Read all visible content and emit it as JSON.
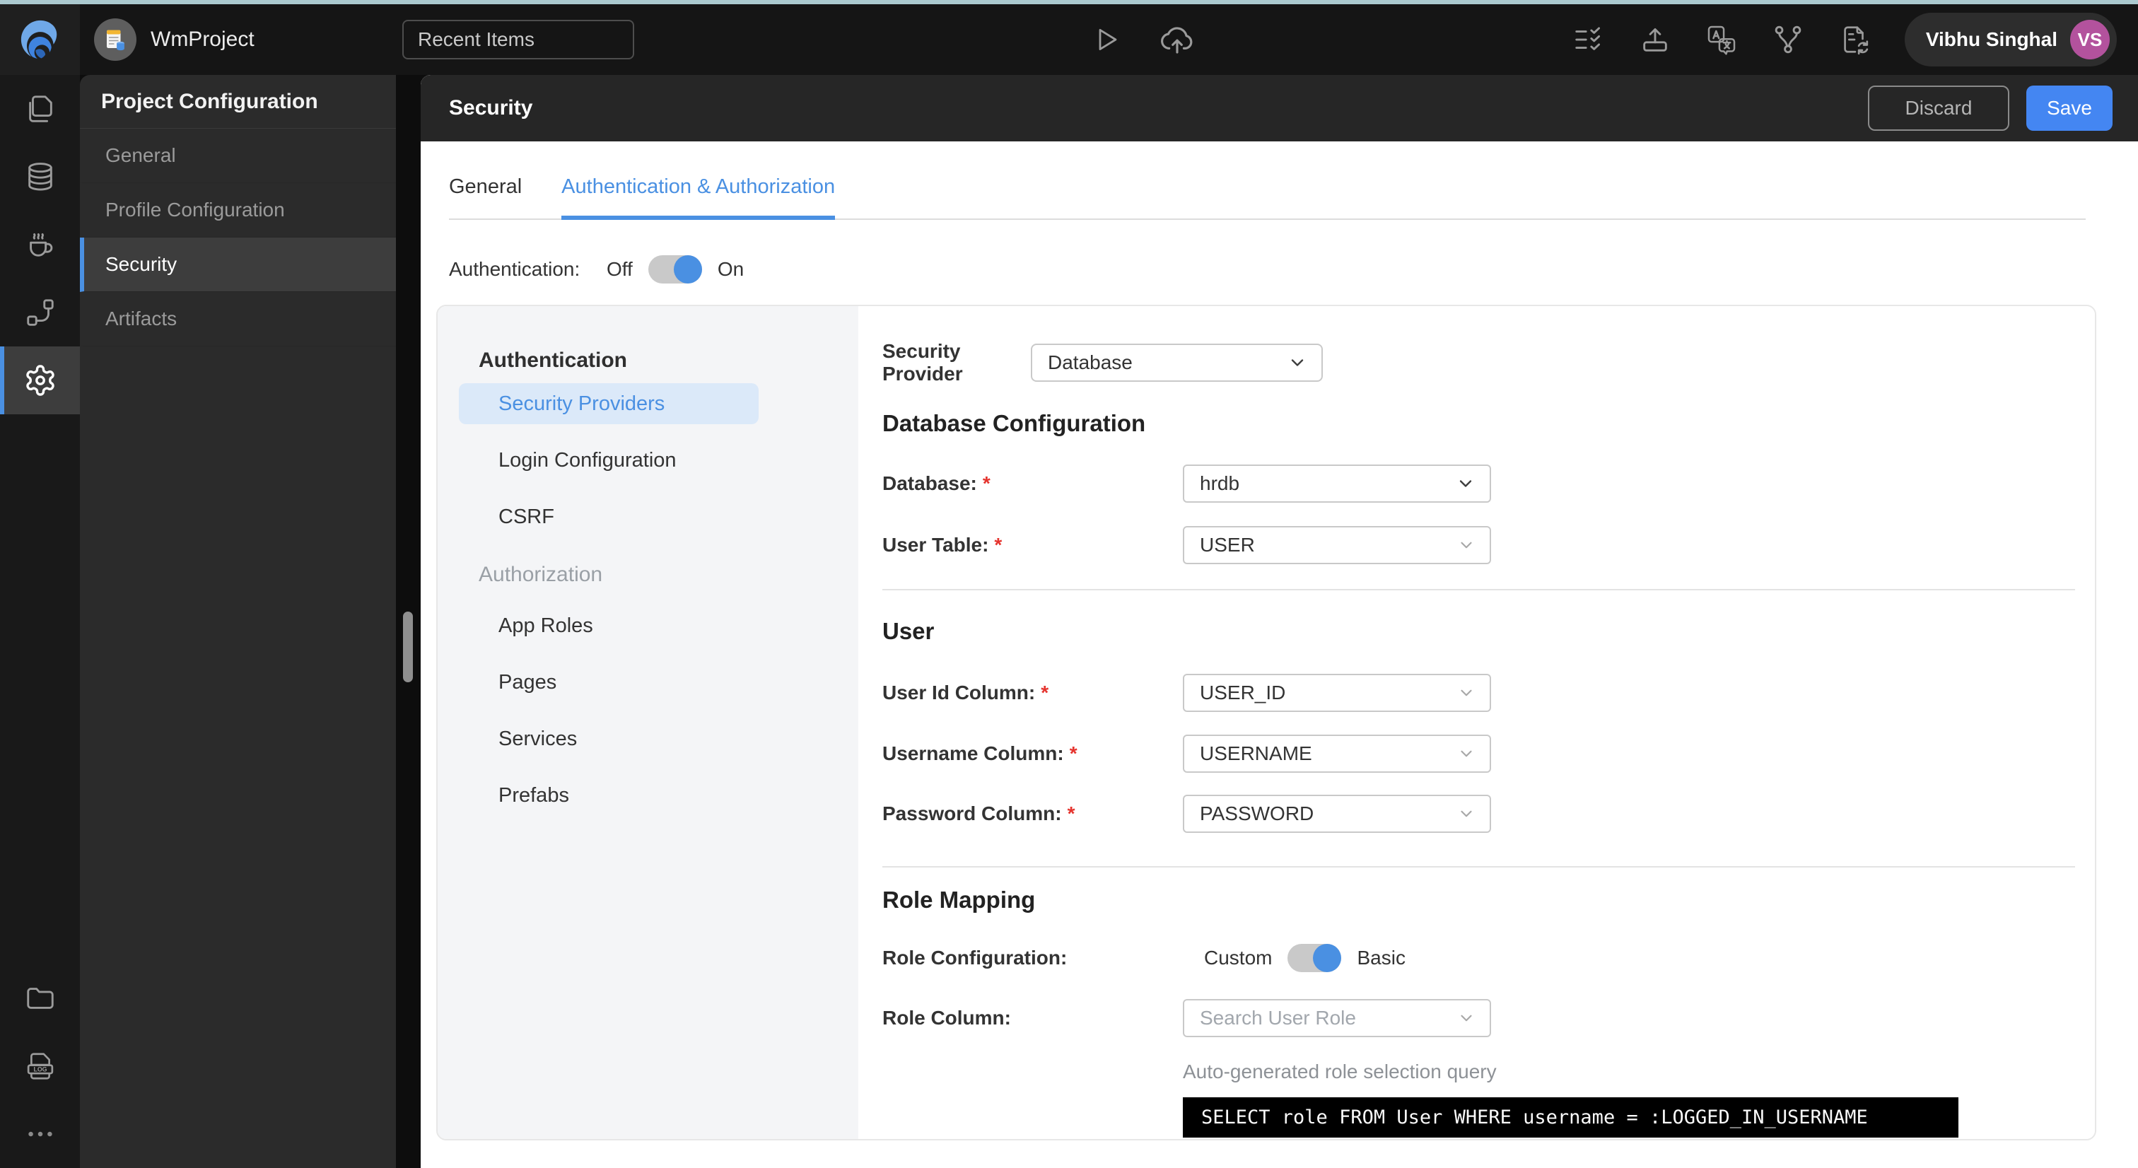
{
  "topbar": {
    "project_name": "WmProject",
    "recent_items_label": "Recent Items",
    "user": {
      "name": "Vibhu Singhal",
      "initials": "VS"
    }
  },
  "rail": {
    "log_badge": "LOG"
  },
  "sidebar": {
    "title": "Project Configuration",
    "items": [
      {
        "label": "General",
        "active": false
      },
      {
        "label": "Profile Configuration",
        "active": false
      },
      {
        "label": "Security",
        "active": true
      },
      {
        "label": "Artifacts",
        "active": false
      }
    ]
  },
  "page": {
    "title": "Security",
    "discard_label": "Discard",
    "save_label": "Save",
    "tabs": [
      {
        "label": "General",
        "active": false
      },
      {
        "label": "Authentication & Authorization",
        "active": true
      }
    ]
  },
  "auth_toggle": {
    "label": "Authentication:",
    "off_label": "Off",
    "on_label": "On",
    "state": "on"
  },
  "panel_nav": {
    "section1_title": "Authentication",
    "section1_items": [
      {
        "label": "Security Providers",
        "active": true
      },
      {
        "label": "Login Configuration",
        "active": false
      },
      {
        "label": "CSRF",
        "active": false
      }
    ],
    "section2_title": "Authorization",
    "section2_items": [
      {
        "label": "App Roles"
      },
      {
        "label": "Pages"
      },
      {
        "label": "Services"
      },
      {
        "label": "Prefabs"
      }
    ]
  },
  "form": {
    "required_marker": "*",
    "security_provider": {
      "label": "Security Provider",
      "value": "Database"
    },
    "database_section": {
      "heading": "Database Configuration",
      "database": {
        "label": "Database:",
        "value": "hrdb",
        "required": true
      },
      "user_table": {
        "label": "User Table:",
        "value": "USER",
        "required": true
      }
    },
    "user_section": {
      "heading": "User",
      "user_id": {
        "label": "User Id Column:",
        "value": "USER_ID",
        "required": true
      },
      "username": {
        "label": "Username Column:",
        "value": "USERNAME",
        "required": true
      },
      "password": {
        "label": "Password Column:",
        "value": "PASSWORD",
        "required": true
      }
    },
    "role_section": {
      "heading": "Role Mapping",
      "role_configuration_label": "Role Configuration:",
      "custom_label": "Custom",
      "basic_label": "Basic",
      "state": "basic",
      "role_column_label": "Role Column:",
      "role_column_placeholder": "Search User Role",
      "query_caption": "Auto-generated role selection query",
      "query": "SELECT role FROM User WHERE username = :LOGGED_IN_USERNAME"
    }
  },
  "colors": {
    "accent": "#4a90e2",
    "save_button": "#4486f2",
    "required": "#e5342e",
    "avatar": "#b3529d",
    "top_strip": "#abc9cf",
    "code_background": "#000000"
  }
}
